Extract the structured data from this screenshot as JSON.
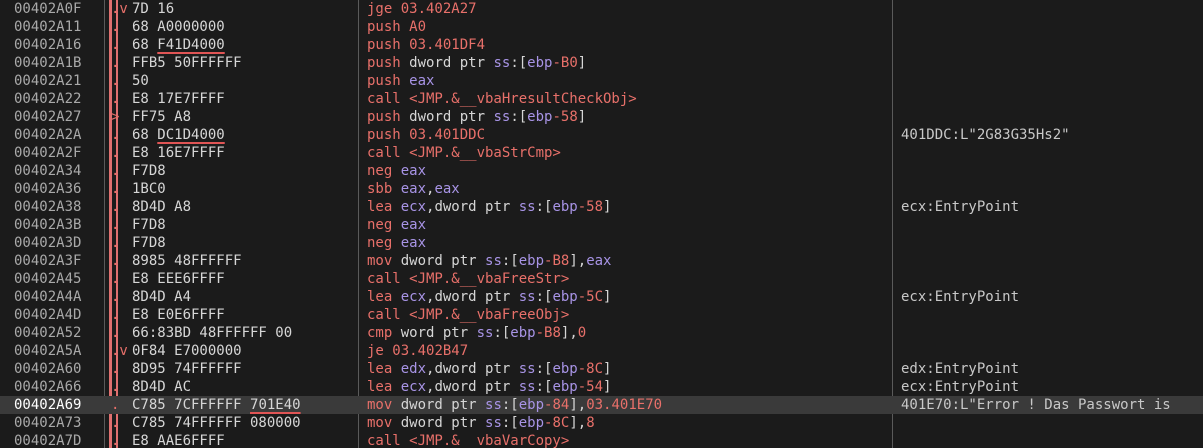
{
  "rows": [
    {
      "addr": "00402A0F",
      "jump": ".v",
      "bytes": "7D 16",
      "instr": [
        [
          "mn",
          "jge "
        ],
        [
          "num",
          "03.402A27"
        ]
      ],
      "comment": ""
    },
    {
      "addr": "00402A11",
      "jump": ".",
      "bytes": "68 A0000000",
      "instr": [
        [
          "mn",
          "push "
        ],
        [
          "num",
          "A0"
        ]
      ],
      "comment": ""
    },
    {
      "addr": "00402A16",
      "jump": ".",
      "bytes": "68 F41D4000",
      "bytes_u": "F41D4000",
      "instr": [
        [
          "mn",
          "push "
        ],
        [
          "num",
          "03.401DF4"
        ]
      ],
      "comment": ""
    },
    {
      "addr": "00402A1B",
      "jump": ".",
      "bytes": "FFB5 50FFFFFF",
      "instr": [
        [
          "mn",
          "push "
        ],
        [
          "txt",
          "dword ptr "
        ],
        [
          "reg",
          "ss"
        ],
        [
          "txt",
          ":["
        ],
        [
          "reg",
          "ebp"
        ],
        [
          "num",
          "-B0"
        ],
        [
          "txt",
          "]"
        ]
      ],
      "comment": ""
    },
    {
      "addr": "00402A21",
      "jump": ".",
      "bytes": "50",
      "instr": [
        [
          "mn",
          "push "
        ],
        [
          "reg",
          "eax"
        ]
      ],
      "comment": ""
    },
    {
      "addr": "00402A22",
      "jump": ".",
      "bytes": "E8 17E7FFFF",
      "instr": [
        [
          "call",
          "call <JMP.&__vbaHresultCheckObj>"
        ]
      ],
      "comment": ""
    },
    {
      "addr": "00402A27",
      "jump": ">",
      "bytes": "FF75 A8",
      "instr": [
        [
          "mn",
          "push "
        ],
        [
          "txt",
          "dword ptr "
        ],
        [
          "reg",
          "ss"
        ],
        [
          "txt",
          ":["
        ],
        [
          "reg",
          "ebp"
        ],
        [
          "num",
          "-58"
        ],
        [
          "txt",
          "]"
        ]
      ],
      "comment": ""
    },
    {
      "addr": "00402A2A",
      "jump": ".",
      "bytes": "68 DC1D4000",
      "bytes_u": "DC1D4000",
      "instr": [
        [
          "mn",
          "push "
        ],
        [
          "num",
          "03.401DDC"
        ]
      ],
      "comment": "401DDC:L\"2G83G35Hs2\""
    },
    {
      "addr": "00402A2F",
      "jump": ".",
      "bytes": "E8 16E7FFFF",
      "instr": [
        [
          "call",
          "call <JMP.&__vbaStrCmp>"
        ]
      ],
      "comment": ""
    },
    {
      "addr": "00402A34",
      "jump": ".",
      "bytes": "F7D8",
      "instr": [
        [
          "mn",
          "neg "
        ],
        [
          "reg",
          "eax"
        ]
      ],
      "comment": ""
    },
    {
      "addr": "00402A36",
      "jump": ".",
      "bytes": "1BC0",
      "instr": [
        [
          "mn",
          "sbb "
        ],
        [
          "reg",
          "eax"
        ],
        [
          "txt",
          ","
        ],
        [
          "reg",
          "eax"
        ]
      ],
      "comment": ""
    },
    {
      "addr": "00402A38",
      "jump": ".",
      "bytes": "8D4D A8",
      "instr": [
        [
          "mn",
          "lea "
        ],
        [
          "reg",
          "ecx"
        ],
        [
          "txt",
          ",dword ptr "
        ],
        [
          "reg",
          "ss"
        ],
        [
          "txt",
          ":["
        ],
        [
          "reg",
          "ebp"
        ],
        [
          "num",
          "-58"
        ],
        [
          "txt",
          "]"
        ]
      ],
      "comment": "ecx:EntryPoint"
    },
    {
      "addr": "00402A3B",
      "jump": ".",
      "bytes": "F7D8",
      "instr": [
        [
          "mn",
          "neg "
        ],
        [
          "reg",
          "eax"
        ]
      ],
      "comment": ""
    },
    {
      "addr": "00402A3D",
      "jump": ".",
      "bytes": "F7D8",
      "instr": [
        [
          "mn",
          "neg "
        ],
        [
          "reg",
          "eax"
        ]
      ],
      "comment": ""
    },
    {
      "addr": "00402A3F",
      "jump": ".",
      "bytes": "8985 48FFFFFF",
      "instr": [
        [
          "mn",
          "mov "
        ],
        [
          "txt",
          "dword ptr "
        ],
        [
          "reg",
          "ss"
        ],
        [
          "txt",
          ":["
        ],
        [
          "reg",
          "ebp"
        ],
        [
          "num",
          "-B8"
        ],
        [
          "txt",
          "],"
        ],
        [
          "reg",
          "eax"
        ]
      ],
      "comment": ""
    },
    {
      "addr": "00402A45",
      "jump": ".",
      "bytes": "E8 EEE6FFFF",
      "instr": [
        [
          "call",
          "call <JMP.&__vbaFreeStr>"
        ]
      ],
      "comment": ""
    },
    {
      "addr": "00402A4A",
      "jump": ".",
      "bytes": "8D4D A4",
      "instr": [
        [
          "mn",
          "lea "
        ],
        [
          "reg",
          "ecx"
        ],
        [
          "txt",
          ",dword ptr "
        ],
        [
          "reg",
          "ss"
        ],
        [
          "txt",
          ":["
        ],
        [
          "reg",
          "ebp"
        ],
        [
          "num",
          "-5C"
        ],
        [
          "txt",
          "]"
        ]
      ],
      "comment": "ecx:EntryPoint"
    },
    {
      "addr": "00402A4D",
      "jump": ".",
      "bytes": "E8 E0E6FFFF",
      "instr": [
        [
          "call",
          "call <JMP.&__vbaFreeObj>"
        ]
      ],
      "comment": ""
    },
    {
      "addr": "00402A52",
      "jump": ".",
      "bytes": "66:83BD 48FFFFFF 00",
      "instr": [
        [
          "mn",
          "cmp "
        ],
        [
          "txt",
          "word ptr "
        ],
        [
          "reg",
          "ss"
        ],
        [
          "txt",
          ":["
        ],
        [
          "reg",
          "ebp"
        ],
        [
          "num",
          "-B8"
        ],
        [
          "txt",
          "],"
        ],
        [
          "num",
          "0"
        ]
      ],
      "comment": ""
    },
    {
      "addr": "00402A5A",
      "jump": ".v",
      "bytes": "0F84 E7000000",
      "instr": [
        [
          "jmp",
          "je "
        ],
        [
          "num",
          "03.402B47"
        ]
      ],
      "comment": ""
    },
    {
      "addr": "00402A60",
      "jump": ".",
      "bytes": "8D95 74FFFFFF",
      "instr": [
        [
          "mn",
          "lea "
        ],
        [
          "reg",
          "edx"
        ],
        [
          "txt",
          ",dword ptr "
        ],
        [
          "reg",
          "ss"
        ],
        [
          "txt",
          ":["
        ],
        [
          "reg",
          "ebp"
        ],
        [
          "num",
          "-8C"
        ],
        [
          "txt",
          "]"
        ]
      ],
      "comment": "edx:EntryPoint"
    },
    {
      "addr": "00402A66",
      "jump": ".",
      "bytes": "8D4D AC",
      "instr": [
        [
          "mn",
          "lea "
        ],
        [
          "reg",
          "ecx"
        ],
        [
          "txt",
          ",dword ptr "
        ],
        [
          "reg",
          "ss"
        ],
        [
          "txt",
          ":["
        ],
        [
          "reg",
          "ebp"
        ],
        [
          "num",
          "-54"
        ],
        [
          "txt",
          "]"
        ]
      ],
      "comment": "ecx:EntryPoint"
    },
    {
      "addr": "00402A69",
      "jump": ".",
      "bytes": "C785 7CFFFFFF 701E40",
      "bytes_u": "701E40",
      "selected": true,
      "instr": [
        [
          "mn",
          "mov "
        ],
        [
          "txt",
          "dword ptr "
        ],
        [
          "reg",
          "ss"
        ],
        [
          "txt",
          ":["
        ],
        [
          "reg",
          "ebp"
        ],
        [
          "num",
          "-84"
        ],
        [
          "txt",
          "],"
        ],
        [
          "num",
          "03.401E70"
        ]
      ],
      "comment": "401E70:L\"Error ! Das Passwort is"
    },
    {
      "addr": "00402A73",
      "jump": ".",
      "bytes": "C785 74FFFFFF 080000",
      "instr": [
        [
          "mn",
          "mov "
        ],
        [
          "txt",
          "dword ptr "
        ],
        [
          "reg",
          "ss"
        ],
        [
          "txt",
          ":["
        ],
        [
          "reg",
          "ebp"
        ],
        [
          "num",
          "-8C"
        ],
        [
          "txt",
          "],"
        ],
        [
          "num",
          "8"
        ]
      ],
      "comment": ""
    },
    {
      "addr": "00402A7D",
      "jump": ".",
      "bytes": "E8 AAE6FFFF",
      "instr": [
        [
          "call",
          "call <JMP.&__vbaVarCopy>"
        ]
      ],
      "comment": ""
    }
  ]
}
